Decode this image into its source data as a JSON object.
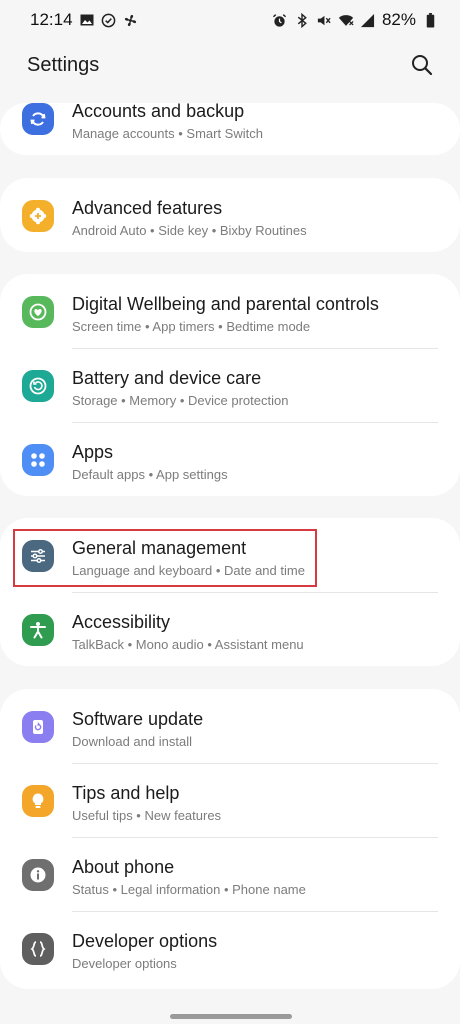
{
  "status_bar": {
    "time": "12:14",
    "battery": "82%",
    "left_icons": [
      "gallery-icon",
      "check-circle-icon",
      "fan-icon"
    ],
    "right_icons": [
      "alarm-icon",
      "bluetooth-icon",
      "mute-icon",
      "wifi-icon",
      "signal-icon",
      "battery-icon"
    ]
  },
  "header": {
    "title": "Settings",
    "search_icon": "search-icon"
  },
  "groups": [
    {
      "items": [
        {
          "id": "accounts",
          "title": "Accounts and backup",
          "subtitle": "Manage accounts  •  Smart Switch",
          "icon": "sync-icon",
          "color": "#3d6fe0"
        }
      ]
    },
    {
      "items": [
        {
          "id": "advanced",
          "title": "Advanced features",
          "subtitle": "Android Auto  •  Side key  •  Bixby Routines",
          "icon": "gear-plus-icon",
          "color": "#f4b02a"
        }
      ]
    },
    {
      "items": [
        {
          "id": "wellbeing",
          "title": "Digital Wellbeing and parental controls",
          "subtitle": "Screen time  •  App timers  •  Bedtime mode",
          "icon": "heart-circle-icon",
          "color": "#58b85c"
        },
        {
          "id": "battery",
          "title": "Battery and device care",
          "subtitle": "Storage  •  Memory  •  Device protection",
          "icon": "refresh-circle-icon",
          "color": "#1ea896"
        },
        {
          "id": "apps",
          "title": "Apps",
          "subtitle": "Default apps  •  App settings",
          "icon": "grid-icon",
          "color": "#4f8ef5"
        }
      ]
    },
    {
      "items": [
        {
          "id": "general",
          "title": "General management",
          "subtitle": "Language and keyboard  •  Date and time",
          "icon": "sliders-icon",
          "color": "#4a6880"
        },
        {
          "id": "accessibility",
          "title": "Accessibility",
          "subtitle": "TalkBack  •  Mono audio  •  Assistant menu",
          "icon": "person-icon",
          "color": "#2f9c4f"
        }
      ]
    },
    {
      "items": [
        {
          "id": "software",
          "title": "Software update",
          "subtitle": "Download and install",
          "icon": "update-icon",
          "color": "#8a7ef0"
        },
        {
          "id": "tips",
          "title": "Tips and help",
          "subtitle": "Useful tips  •  New features",
          "icon": "bulb-icon",
          "color": "#f4a62a"
        },
        {
          "id": "about",
          "title": "About phone",
          "subtitle": "Status  •  Legal information  •  Phone name",
          "icon": "info-icon",
          "color": "#6f6f6f"
        },
        {
          "id": "developer",
          "title": "Developer options",
          "subtitle": "Developer options",
          "icon": "braces-icon",
          "color": "#5f5f5f"
        }
      ]
    }
  ]
}
